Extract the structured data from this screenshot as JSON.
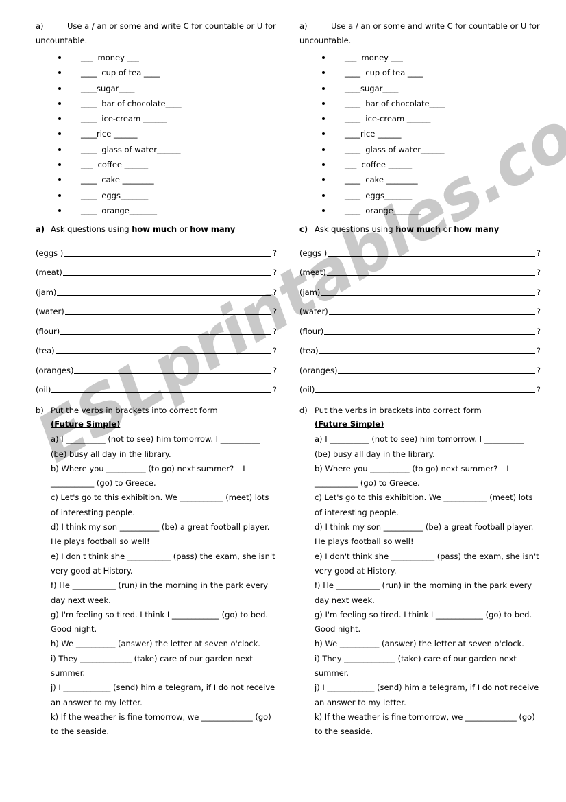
{
  "watermark": {
    "text": "ESLprintables.com",
    "color": "#c9c9c9"
  },
  "columns": [
    {
      "id": "left",
      "task_a": {
        "tag": "a)",
        "instruction": "Use a / an or some and write C for countable or U for uncountable.",
        "items": [
          "___  money ___",
          "____  cup of tea ____",
          "____sugar____",
          "____  bar of chocolate____",
          "____  ice-cream ______",
          "____rice ______",
          "____  glass of water______",
          "___  coffee ______",
          "____  cake ________",
          "____  eggs_______",
          "____  orange_______"
        ]
      },
      "task_q": {
        "tag": "a)",
        "lead": "Ask questions using ",
        "em1": "how much",
        "mid": " or ",
        "em2": "how many",
        "prompts": [
          "(eggs )",
          "(meat)",
          "(jam)",
          "(water)",
          "(flour)",
          "(tea)",
          "(oranges)",
          "(oil)"
        ],
        "mark": "?"
      },
      "task_verbs": {
        "tag": "b)",
        "title": "Put the verbs in brackets into correct form",
        "subtitle": "(Future Simple)",
        "items": [
          "a) I __________ (not to see) him tomorrow. I __________ (be) busy all day in the library.",
          "b) Where you __________ (to go) next summer? – I ___________ (go) to Greece.",
          "c) Let's go to this exhibition. We ___________ (meet) lots of interesting people.",
          "d) I think my son __________ (be) a great football player. He plays football so well!",
          "e) I don't think she ___________ (pass) the exam, she isn't very good at History.",
          "f) He ___________ (run) in the morning in the park every day next week.",
          "g) I'm feeling so tired. I think I ____________ (go) to bed. Good night.",
          "h) We __________ (answer) the letter at seven o'clock.",
          "i) They _____________ (take) care of our garden next summer.",
          "j) I ____________ (send) him a telegram, if I do not receive an answer to my letter.",
          "k) If the weather is fine tomorrow, we _____________ (go) to the seaside."
        ]
      }
    },
    {
      "id": "right",
      "task_a": {
        "tag": "a)",
        "instruction": "Use a / an or some and write C for countable or U for uncountable.",
        "items": [
          "___  money ___",
          "____  cup of tea ____",
          "____sugar____",
          "____  bar of chocolate____",
          "____  ice-cream ______",
          "____rice ______",
          "____  glass of water______",
          "___  coffee ______",
          "____  cake ________",
          "____  eggs_______",
          "____  orange_______"
        ]
      },
      "task_q": {
        "tag": "c)",
        "lead": "Ask questions using ",
        "em1": "how much",
        "mid": " or ",
        "em2": "how many",
        "prompts": [
          "(eggs )",
          "(meat)",
          "(jam)",
          "(water)",
          "(flour)",
          "(tea)",
          "(oranges)",
          "(oil)"
        ],
        "mark": "?"
      },
      "task_verbs": {
        "tag": "d)",
        "title": "Put the verbs in brackets into correct form",
        "subtitle": "(Future Simple)",
        "items": [
          "a) I __________ (not to see) him tomorrow. I __________ (be) busy all day in the library.",
          "b) Where you __________ (to go) next summer? – I ___________ (go) to Greece.",
          "c) Let's go to this exhibition. We ___________ (meet) lots of interesting people.",
          "d) I think my son __________ (be) a great football player. He plays football so well!",
          "e) I don't think she ___________ (pass) the exam, she isn't very good at History.",
          "f) He ___________ (run) in the morning in the park every day next week.",
          "g) I'm feeling so tired. I think I ____________ (go) to bed. Good night.",
          "h) We __________ (answer) the letter at seven o'clock.",
          "i) They _____________ (take) care of our garden next summer.",
          "j) I ____________ (send) him a telegram, if I do not receive an answer to my letter.",
          "k) If the weather is fine tomorrow, we _____________ (go) to the seaside."
        ]
      }
    }
  ]
}
